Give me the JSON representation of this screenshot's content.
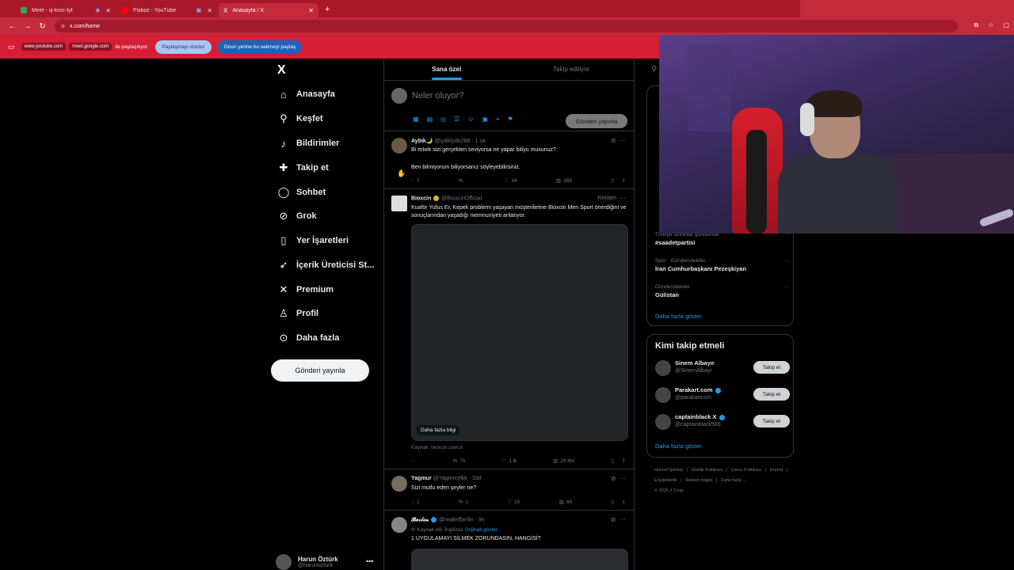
{
  "browser": {
    "tabs": [
      {
        "title": "Meet - iij-kroc-tyf",
        "active": false,
        "favicon_color": "#34a853"
      },
      {
        "title": "Psikoz - YouTube",
        "active": false,
        "favicon_color": "#ff0000"
      },
      {
        "title": "Anasayfa / X",
        "active": true,
        "favicon_color": "#000000"
      }
    ],
    "new_tab": "+",
    "url": "x.com/home"
  },
  "share_bar": {
    "chip1": "www.youtube.com",
    "chip2": "meet.google.com",
    "text": "ile paylaşılıyor",
    "stop_label": "Paylaşmayı durdur",
    "share_label": "Onun yerine bu sekmeyi paylaş"
  },
  "nav": {
    "logo": "X",
    "items": [
      {
        "label": "Anasayfa",
        "icon": "home-icon",
        "glyph": "⌂"
      },
      {
        "label": "Keşfet",
        "icon": "search-icon",
        "glyph": "⚲"
      },
      {
        "label": "Bildirimler",
        "icon": "bell-icon",
        "glyph": "♪"
      },
      {
        "label": "Takip et",
        "icon": "follow-icon",
        "glyph": "✚"
      },
      {
        "label": "Sohbet",
        "icon": "chat-icon",
        "glyph": "◯"
      },
      {
        "label": "Grok",
        "icon": "grok-icon",
        "glyph": "⊘"
      },
      {
        "label": "Yer İşaretleri",
        "icon": "bookmark-icon",
        "glyph": "▯"
      },
      {
        "label": "İçerik Üreticisi St...",
        "icon": "rocket-icon",
        "glyph": "➶"
      },
      {
        "label": "Premium",
        "icon": "x-premium-icon",
        "glyph": "✕"
      },
      {
        "label": "Profil",
        "icon": "profile-icon",
        "glyph": "♙"
      },
      {
        "label": "Daha fazla",
        "icon": "more-icon",
        "glyph": "⊙"
      }
    ],
    "post_button": "Gönderi yayınla",
    "profile": {
      "name": "Harun Öztürk",
      "handle": "@harunozturk"
    }
  },
  "feed": {
    "tabs": [
      {
        "label": "Sana özel",
        "active": true
      },
      {
        "label": "Takip ediliyor",
        "active": false
      }
    ],
    "compose": {
      "placeholder": "Neler oluyor?",
      "post_button": "Gönderi yayınla"
    },
    "tweets": [
      {
        "name": "Aybik🌙",
        "handle": "@iyiliklydir288 · 1 sa",
        "text": "Bi erkek sizi gerçekten seviyorsa ne yapar biliyo musunuz?",
        "text2": "Ben bilmiyorum biliyorsanız söyleyebilirsiniz.",
        "replies": "7",
        "retweets": "",
        "likes": "34",
        "views": "368"
      },
      {
        "name": "Bioxcin",
        "handle": "@BioxcinOfficial",
        "ad": "Reklam",
        "text": "Kuaför Yufus Er, Kepek problemi yaşayan müşterilerine Bioxcin Men Sport önerdiğini ve sonuçlarından yaşadığı memnuniyeti anlatıyor.",
        "media_button": "Daha fazla bilgi",
        "source": "Kaynak: bioxcin.com.tr",
        "replies": "",
        "retweets": "75",
        "likes": "1 B",
        "views": "29 Mn"
      },
      {
        "name": "Yagmur",
        "handle": "@Yagmrcelkk · 33d",
        "text": "Sizi mutlu eden şeyler ne?",
        "replies": "2",
        "retweets": "1",
        "likes": "15",
        "views": "69"
      },
      {
        "name": "𝓑𝓮𝓻𝓵𝓲𝓷",
        "handle": "@realmfberlin · 9s",
        "translate": "Kaynak dili: İngilizce",
        "translate_link": "Orijinali göster",
        "text": "1 UYGULAMAYI SİLMEK ZORUNDASIN, HANGİSİ?"
      }
    ]
  },
  "right": {
    "trends": [
      {
        "context": "Türkiye tarihinde gündemde",
        "title": "#saadetpartisi"
      },
      {
        "context": "Spor · Gündemdekiler",
        "title": "İran Cumhurbaşkanı Pezeşkiyan"
      },
      {
        "context": "Gündemdekiler",
        "title": "Gülistan"
      }
    ],
    "show_more": "Daha fazla göster",
    "who_title": "Kimi takip etmeli",
    "who": [
      {
        "name": "Sinem Albayır",
        "handle": "@SinemAlbayr",
        "verified": false
      },
      {
        "name": "Parakart.com",
        "handle": "@parakartcom",
        "verified": true
      },
      {
        "name": "captainblack X",
        "handle": "@captainblack566",
        "verified": true
      }
    ],
    "follow_label": "Takip et",
    "who_more": "Daha fazla göster",
    "footer": [
      "Hizmet Şartları",
      "|",
      "Gizlilik Politikası",
      "|",
      "Çerez Politikası",
      "|",
      "Imprint",
      "|",
      "Erişilebilirlik",
      "|",
      "Reklam bilgisi",
      "|",
      "Daha fazla ...",
      "© 2025 X Corp."
    ]
  },
  "colors": {
    "accent": "#1d9bf0",
    "chrome": "#c32a3c",
    "background": "#000000"
  }
}
